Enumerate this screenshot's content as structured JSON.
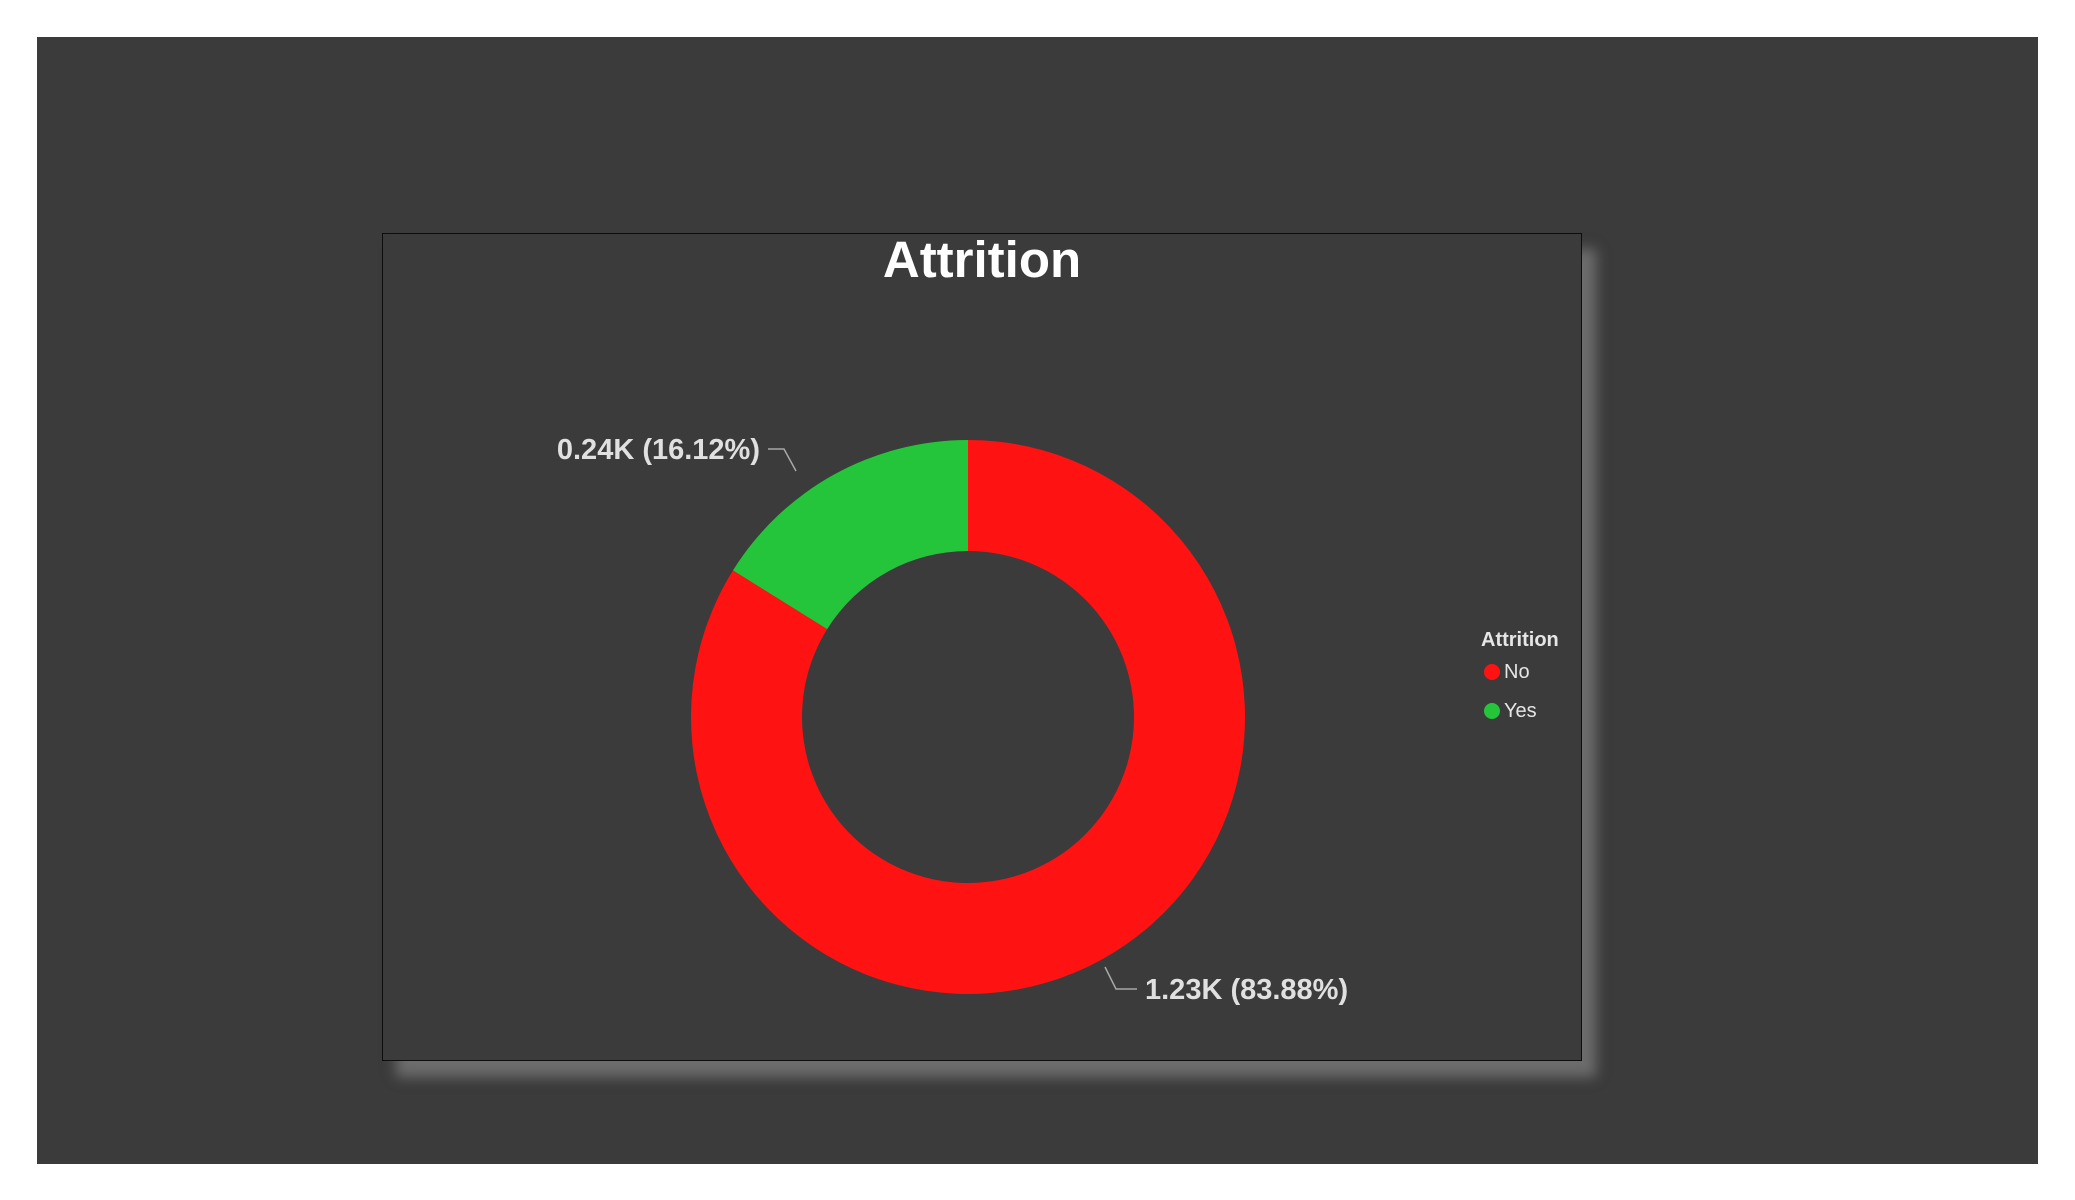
{
  "colors": {
    "no": "#ff1212",
    "yes": "#24c53b",
    "background": "#3b3b3b"
  },
  "chart_data": {
    "type": "pie",
    "variant": "donut",
    "title": "Attrition",
    "categories": [
      "No",
      "Yes"
    ],
    "values": [
      1233,
      237
    ],
    "percentages": [
      83.88,
      16.12
    ],
    "data_labels": [
      "1.23K (83.88%)",
      "0.24K (16.12%)"
    ],
    "colors": [
      "#ff1212",
      "#24c53b"
    ],
    "legend": {
      "title": "Attrition",
      "placement": "right",
      "items": [
        "No",
        "Yes"
      ]
    }
  }
}
